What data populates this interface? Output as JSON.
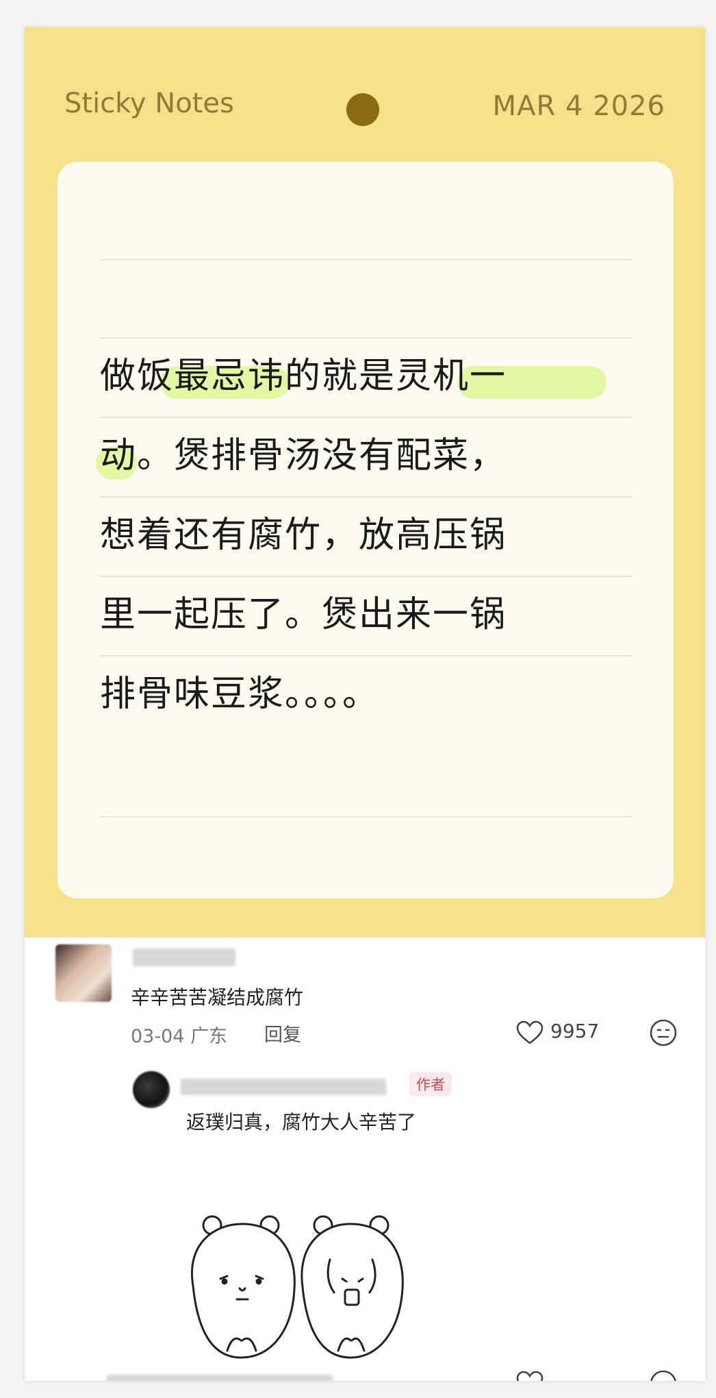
{
  "note": {
    "title": "Sticky Notes",
    "date": "MAR 4 2026",
    "lines": [
      "做饭最忌讳的就是灵机一",
      "动。煲排骨汤没有配菜，",
      "想着还有腐竹，放高压锅",
      "里一起压了。煲出来一锅",
      "排骨味豆浆。。。。"
    ]
  },
  "comments": [
    {
      "text": "辛辛苦苦凝结成腐竹",
      "date": "03-04",
      "location": "广东",
      "reply_label": "回复",
      "likes": "9957"
    },
    {
      "author_badge": "作者",
      "text": "返璞归真，腐竹大人辛苦了"
    }
  ],
  "icons": {
    "like": "heart-outline-icon",
    "emoji": "neutral-face-icon"
  },
  "colors": {
    "note_background": "#f7e08a",
    "paper": "#fdfbf0",
    "highlight": "#dff79a",
    "author_badge": "#d0485a"
  }
}
